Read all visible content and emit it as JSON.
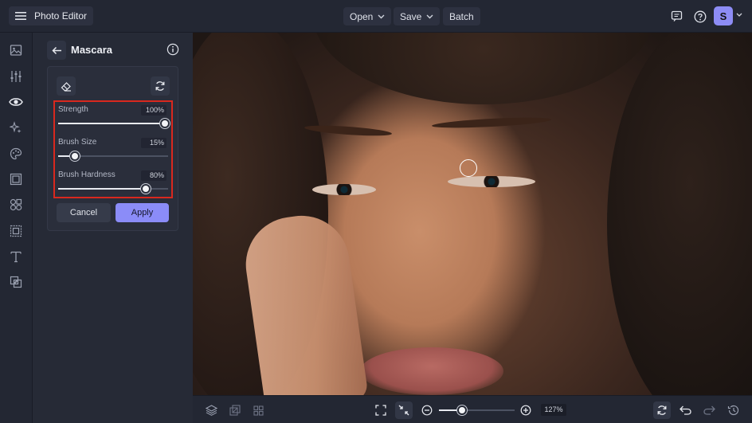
{
  "app": {
    "title": "Photo Editor",
    "avatar_letter": "S"
  },
  "topbar": {
    "open_label": "Open",
    "save_label": "Save",
    "batch_label": "Batch"
  },
  "panel": {
    "title": "Mascara",
    "sliders": [
      {
        "label": "Strength",
        "value_text": "100%",
        "value": 100
      },
      {
        "label": "Brush Size",
        "value_text": "15%",
        "value": 15
      },
      {
        "label": "Brush Hardness",
        "value_text": "80%",
        "value": 80
      }
    ],
    "cancel_label": "Cancel",
    "apply_label": "Apply"
  },
  "zoom": {
    "value_text": "127%",
    "fraction": 0.3
  },
  "colors": {
    "accent": "#8b8cf8",
    "highlight": "#d9281e",
    "bg": "#232733"
  },
  "icons": {
    "leftbar": [
      "image-icon",
      "adjust-sliders-icon",
      "eye-icon",
      "sparkle-effects-icon",
      "palette-icon",
      "frame-icon",
      "shapes-icon",
      "border-icon",
      "text-icon",
      "overlay-icon"
    ]
  }
}
